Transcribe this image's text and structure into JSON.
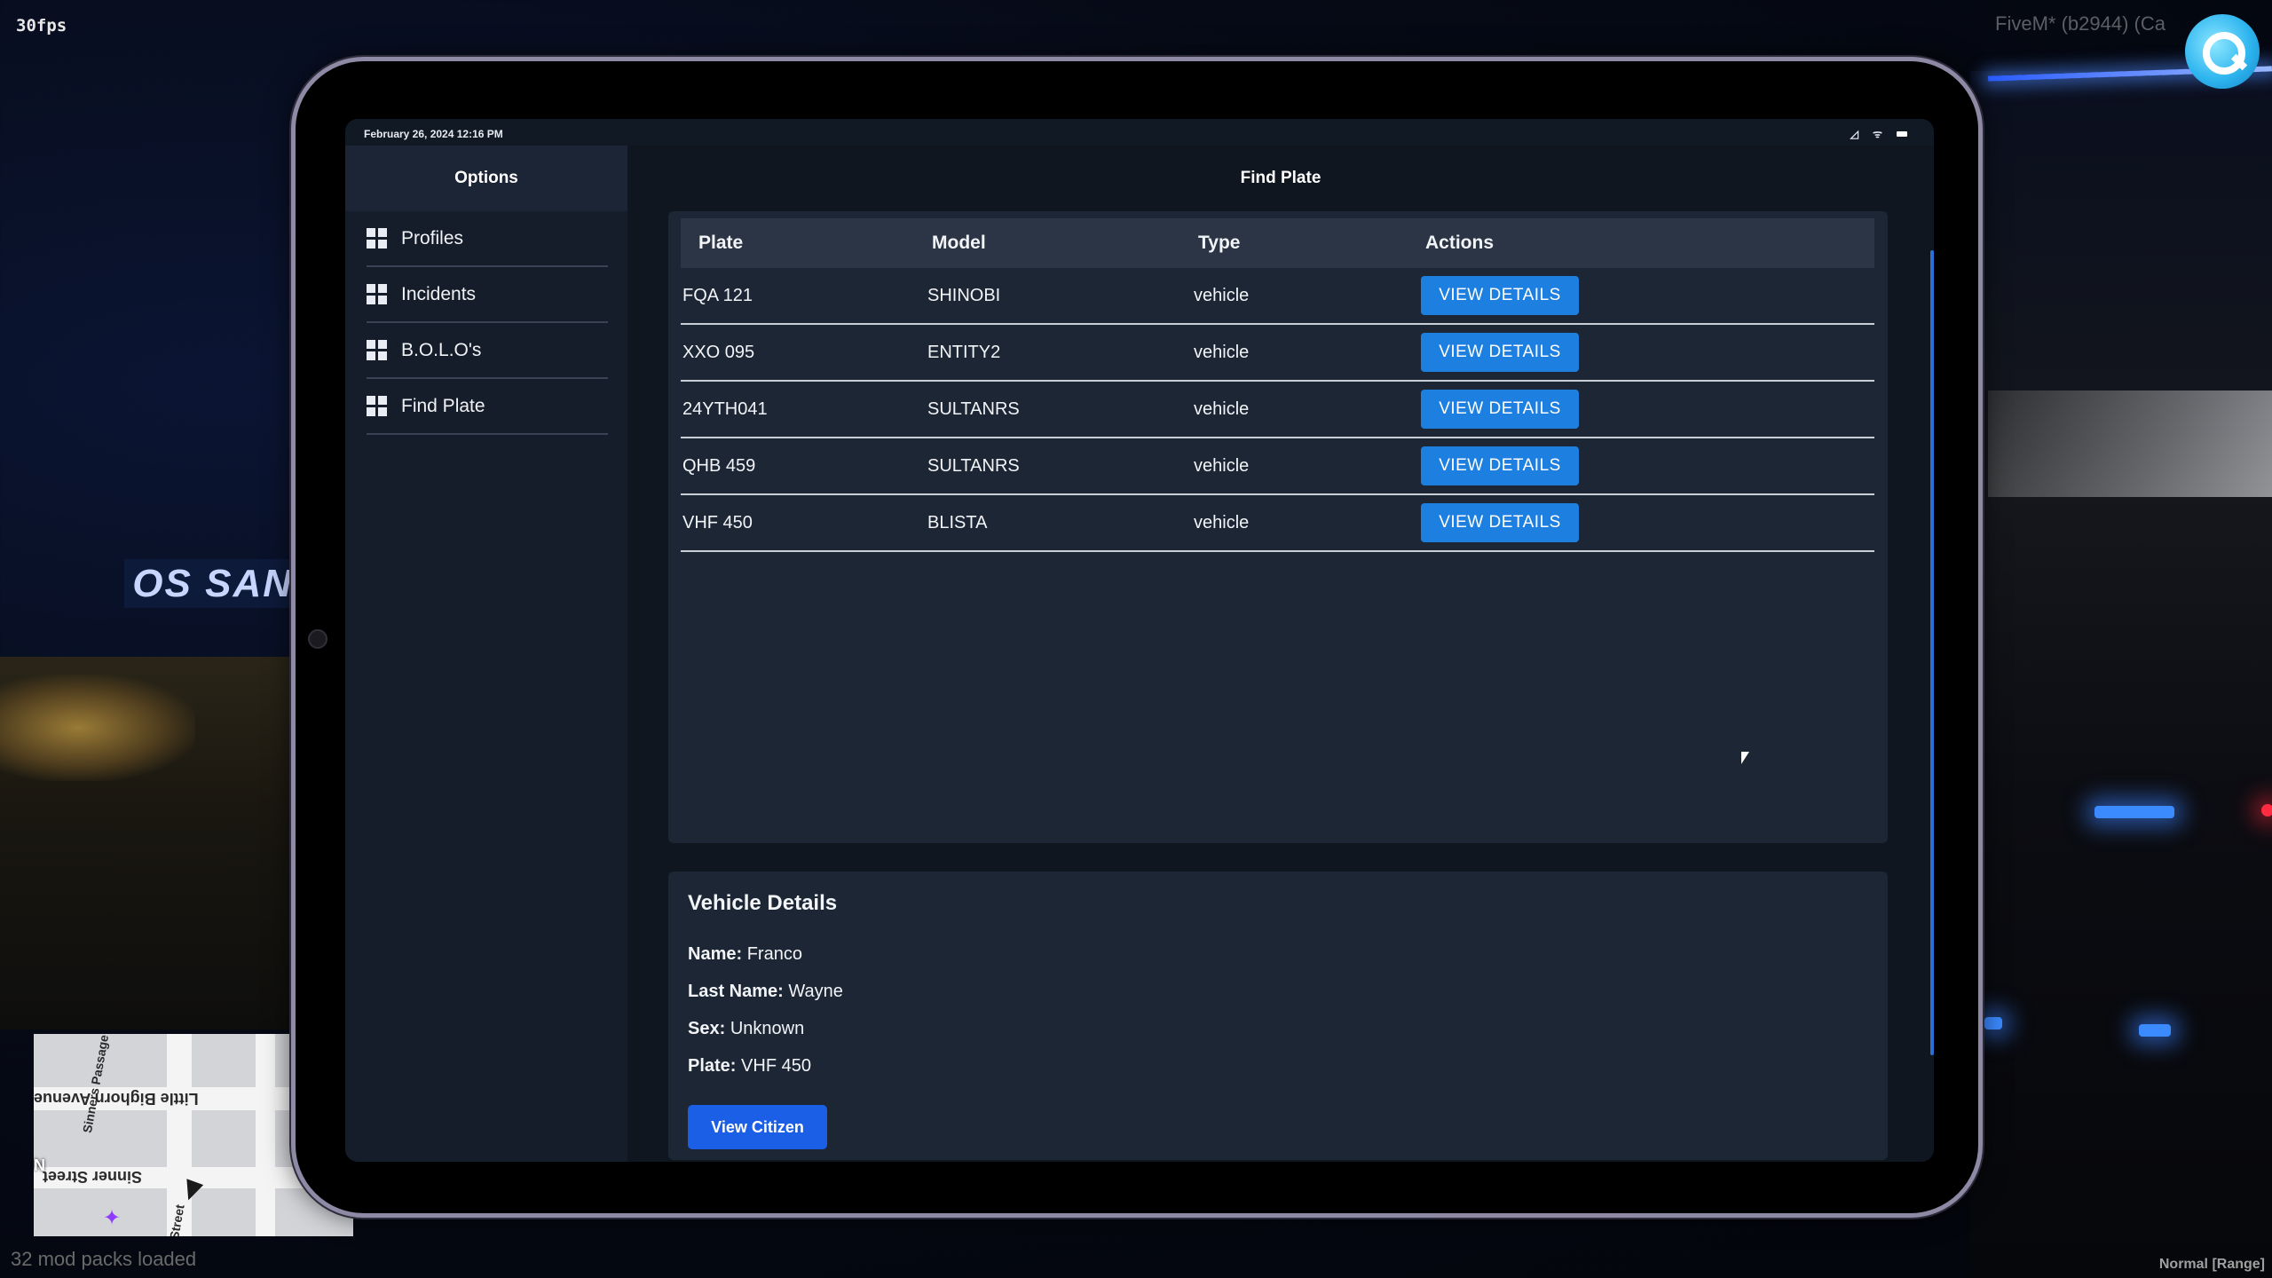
{
  "overlay": {
    "fps": "30fps",
    "client_title": "FiveM* (b2944) (Ca",
    "mod_packs": "32 mod packs loaded",
    "mode": "Normal [Range]",
    "sign_text": "OS SAN"
  },
  "minimap": {
    "north": "N",
    "streets": [
      "Little Bighorn Avenue",
      "Sinner Street",
      "Sinners Passage",
      "Street"
    ]
  },
  "tablet": {
    "statusbar": {
      "datetime": "February 26, 2024 12:16 PM"
    },
    "sidebar": {
      "title": "Options",
      "items": [
        {
          "label": "Profiles",
          "icon": "grid-icon"
        },
        {
          "label": "Incidents",
          "icon": "grid-icon"
        },
        {
          "label": "B.O.L.O's",
          "icon": "grid-icon"
        },
        {
          "label": "Find Plate",
          "icon": "grid-icon"
        }
      ]
    },
    "main": {
      "title": "Find Plate",
      "table": {
        "headers": [
          "Plate",
          "Model",
          "Type",
          "Actions"
        ],
        "rows": [
          {
            "plate": "FQA 121",
            "model": "SHINOBI",
            "type": "vehicle",
            "action": "VIEW DETAILS"
          },
          {
            "plate": "XXO 095",
            "model": "ENTITY2",
            "type": "vehicle",
            "action": "VIEW DETAILS"
          },
          {
            "plate": "24YTH041",
            "model": "SULTANRS",
            "type": "vehicle",
            "action": "VIEW DETAILS"
          },
          {
            "plate": "QHB 459",
            "model": "SULTANRS",
            "type": "vehicle",
            "action": "VIEW DETAILS"
          },
          {
            "plate": "VHF 450",
            "model": "BLISTA",
            "type": "vehicle",
            "action": "VIEW DETAILS"
          }
        ]
      },
      "details": {
        "title": "Vehicle Details",
        "fields": [
          {
            "label": "Name:",
            "value": "Franco"
          },
          {
            "label": "Last Name:",
            "value": "Wayne"
          },
          {
            "label": "Sex:",
            "value": "Unknown"
          },
          {
            "label": "Plate:",
            "value": "VHF 450"
          }
        ],
        "button": "View Citizen"
      }
    }
  },
  "colors": {
    "accent_button": "#1d7fe0",
    "citizen_button": "#1a5fe6",
    "panel": "#1c2635",
    "sidebar": "#151d2b"
  }
}
